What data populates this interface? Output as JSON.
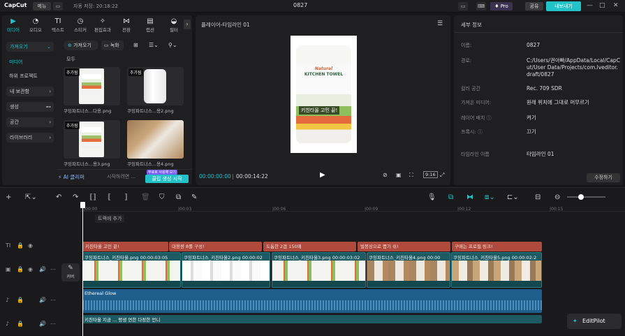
{
  "titlebar": {
    "app": "CapCut",
    "menu": "메뉴",
    "autosave": "자동 저장: 20:18:22",
    "project": "0827",
    "pro": "Pro",
    "share": "공유",
    "export": "내보내기"
  },
  "media": {
    "tabs": [
      "미디어",
      "오디오",
      "텍스트",
      "스티커",
      "편집효과",
      "전환",
      "캡션",
      "필터"
    ],
    "side": {
      "import": "가져오기",
      "media": "미디어",
      "sub": "하위 프로젝트",
      "mine": "내 보관함",
      "gen": "생성",
      "space": "공간",
      "library": "라이브러리"
    },
    "import_btn": "가져오기",
    "record_btn": "녹화",
    "section": "모두",
    "items": [
      {
        "label": "쿠잉파트너스...다용.png",
        "tag": "추가됨"
      },
      {
        "label": "쿠잉파트너스...용2.png",
        "tag": "추가됨"
      },
      {
        "label": "쿠잉파트너스...용3.png",
        "tag": "추가됨"
      },
      {
        "label": "쿠잉파트너스...용4.png",
        "tag": ""
      }
    ],
    "ai_clip": "AI 클리퍼",
    "ai_prompt": "시작하려면 ...",
    "gen_btn": "클립 생성 시작",
    "gen_badge": "무료로 사용해 보기"
  },
  "player": {
    "title": "플레이어-타임라인 01",
    "package_brand": "Natural",
    "package_title": "KITCHEN TOWEL",
    "subtitle": "키친타올 고민 끝!",
    "time_current": "00:00:00:00",
    "time_total": "00:00:14:22",
    "ratio": "9:16"
  },
  "details": {
    "title": "세부 정보",
    "rows": [
      {
        "k": "이름:",
        "v": "0827"
      },
      {
        "k": "경로:",
        "v": "C:/Users/권아빠/AppData/Local/CapCut/User Data/Projects/com.lveditor.draft/0827"
      },
      {
        "k": "컬러 공간",
        "v": "Rec. 709 SDR"
      },
      {
        "k": "가져온 미디어:",
        "v": "원래 위치에 그대로 머무르기"
      },
      {
        "k": "레이어 배치",
        "v": "켜기"
      },
      {
        "k": "프록시:",
        "v": "끄기"
      },
      {
        "k": "타임라인 이름",
        "v": "타임라인 01"
      }
    ],
    "modify": "수정하기"
  },
  "timeline": {
    "ruler": [
      "|00:00",
      "|00:03",
      "|00:06",
      "|00:09",
      "|00:12",
      "|00:15"
    ],
    "add_track": "트랙에 추가",
    "cover": "커버",
    "text_clips": [
      "키친타올 고민 끝!",
      "대용량 8롤 구성!",
      "도톰한 2겹 150매",
      "벌봉상으로 뽑기 쉬!",
      "구매는 프로필 링크!"
    ],
    "video_clips": [
      {
        "label": "쿠잉파트너스_키친타올.png",
        "time": "00:00:03:05"
      },
      {
        "label": "쿠잉파트너스_키친타올2.png",
        "time": "00:00:02"
      },
      {
        "label": "쿠잉파트너스_키친타올3.png",
        "time": "00:00:03:02"
      },
      {
        "label": "쿠잉파트너스_키친타올4.png",
        "time": "00:00"
      },
      {
        "label": "쿠잉파트너스_키친타올5.png",
        "time": "00:00:02:2"
      }
    ],
    "audio": "Ethereal Glow",
    "voiceover": "키친타올 지금 ...  평생 연한 다정한 언니",
    "editpilot": "EditPilot"
  }
}
